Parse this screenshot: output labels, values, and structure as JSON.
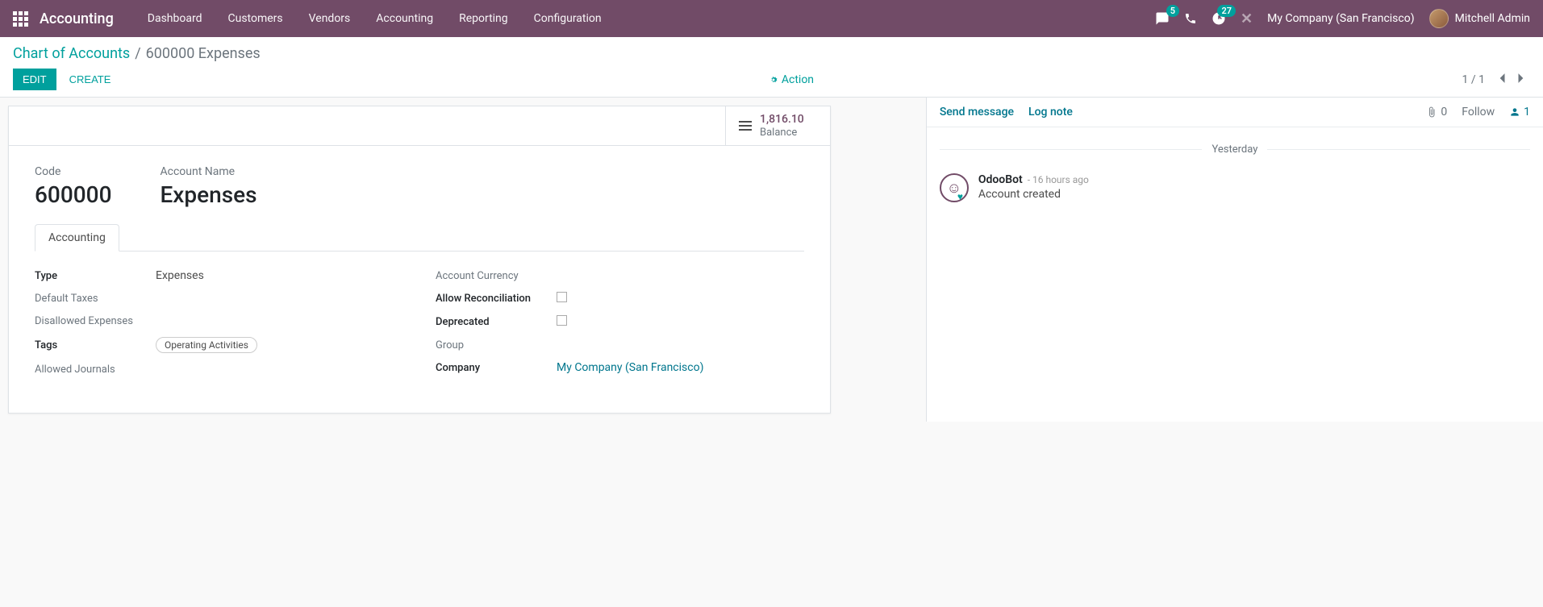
{
  "nav": {
    "brand": "Accounting",
    "menu": [
      "Dashboard",
      "Customers",
      "Vendors",
      "Accounting",
      "Reporting",
      "Configuration"
    ],
    "discuss_badge": "5",
    "activities_badge": "27",
    "company": "My Company (San Francisco)",
    "user": "Mitchell Admin"
  },
  "breadcrumb": {
    "parent": "Chart of Accounts",
    "current": "600000 Expenses"
  },
  "cp": {
    "edit": "Edit",
    "create": "Create",
    "action": "Action",
    "pager": "1 / 1"
  },
  "stat": {
    "balance_value": "1,816.10",
    "balance_label": "Balance"
  },
  "record": {
    "code_label": "Code",
    "code_value": "600000",
    "name_label": "Account Name",
    "name_value": "Expenses"
  },
  "tabs": {
    "accounting": "Accounting"
  },
  "fields": {
    "type_label": "Type",
    "type_value": "Expenses",
    "default_taxes_label": "Default Taxes",
    "disallowed_label": "Disallowed Expenses",
    "tags_label": "Tags",
    "tags_value": "Operating Activities",
    "allowed_journals_label": "Allowed Journals",
    "currency_label": "Account Currency",
    "reconcile_label": "Allow Reconciliation",
    "deprecated_label": "Deprecated",
    "group_label": "Group",
    "company_label": "Company",
    "company_value": "My Company (San Francisco)"
  },
  "chatter": {
    "send": "Send message",
    "log": "Log note",
    "attach_count": "0",
    "follow": "Follow",
    "follower_count": "1",
    "date_divider": "Yesterday",
    "msg_author": "OdooBot",
    "msg_time": "- 16 hours ago",
    "msg_content": "Account created"
  }
}
